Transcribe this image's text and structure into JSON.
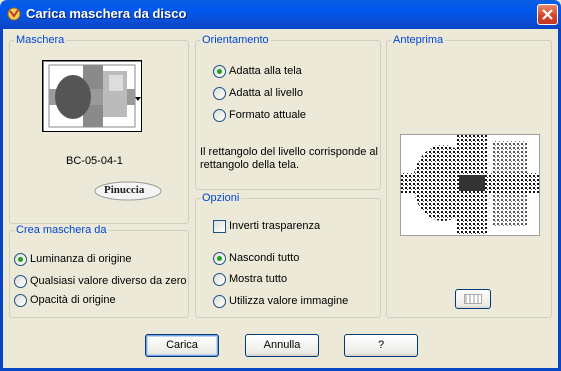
{
  "window": {
    "title": "Carica maschera da disco",
    "icon": "app-icon",
    "close_icon": "close-icon"
  },
  "maschera": {
    "legend": "Maschera",
    "mask_name": "BC-05-04-1",
    "logo_text": "Pinuccia",
    "dropdown_icon": "dropdown-arrow-icon"
  },
  "crea": {
    "legend": "Crea maschera da",
    "options": [
      {
        "label": "Luminanza di origine",
        "selected": true
      },
      {
        "label": "Qualsiasi valore diverso da zero",
        "selected": false
      },
      {
        "label": "Opacità di origine",
        "selected": false
      }
    ]
  },
  "orientamento": {
    "legend": "Orientamento",
    "options": [
      {
        "label": "Adatta alla tela",
        "selected": true
      },
      {
        "label": "Adatta al livello",
        "selected": false
      },
      {
        "label": "Formato attuale",
        "selected": false
      }
    ],
    "description": "Il rettangolo del livello corrisponde al rettangolo della tela."
  },
  "opzioni": {
    "legend": "Opzioni",
    "invert_label": "Inverti trasparenza",
    "invert_checked": false,
    "options": [
      {
        "label": "Nascondi tutto",
        "selected": true
      },
      {
        "label": "Mostra tutto",
        "selected": false
      },
      {
        "label": "Utilizza valore immagine",
        "selected": false
      }
    ]
  },
  "anteprima": {
    "legend": "Anteprima",
    "preview_button_icon": "preview-toggle-icon"
  },
  "buttons": {
    "carica": "Carica",
    "annulla": "Annulla",
    "help": "?"
  },
  "colors": {
    "title_bar": "#0058ee",
    "legend_text": "#0046d5",
    "dialog_bg": "#ece9d8",
    "radio_dot": "#21a121"
  }
}
